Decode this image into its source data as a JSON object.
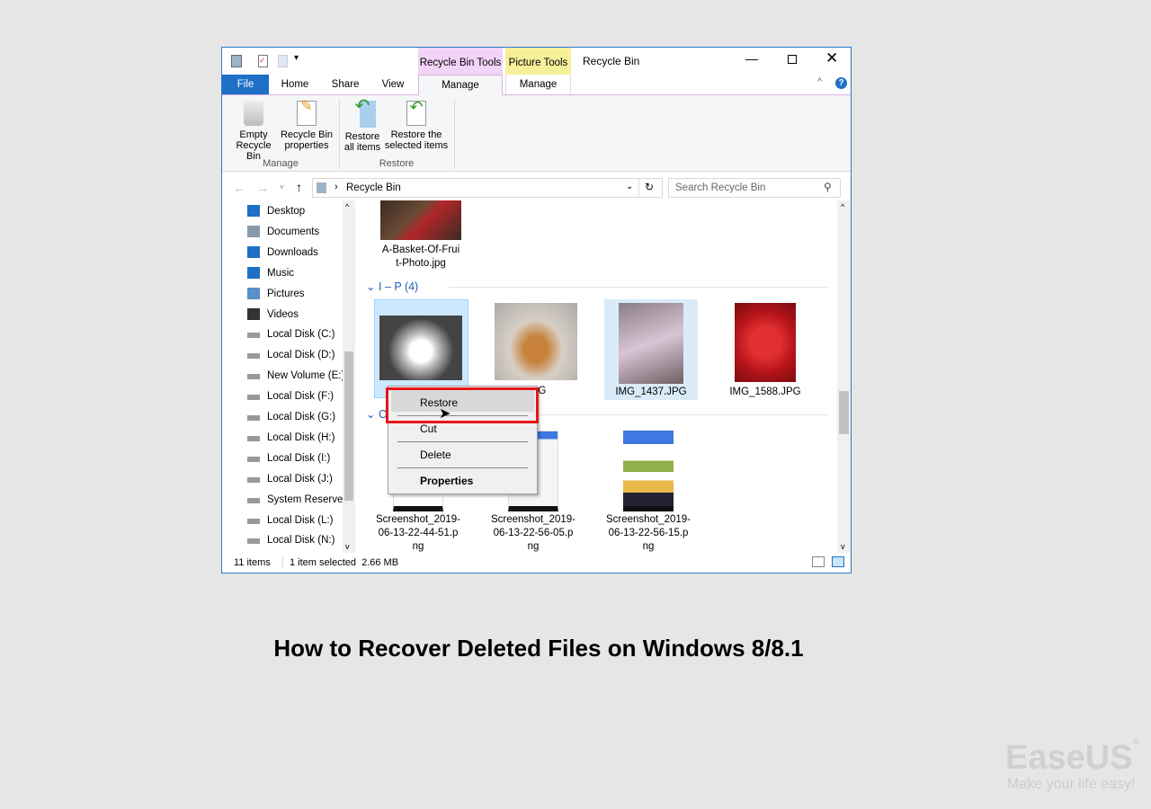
{
  "window": {
    "title": "Recycle Bin",
    "contextual_tabs": [
      "Recycle Bin Tools",
      "Picture Tools"
    ]
  },
  "tabs": {
    "file": "File",
    "home": "Home",
    "share": "Share",
    "view": "View",
    "manage1": "Manage",
    "manage2": "Manage"
  },
  "ribbon": {
    "empty": [
      "Empty",
      "Recycle Bin"
    ],
    "props": [
      "Recycle Bin",
      "properties"
    ],
    "restore_all": [
      "Restore",
      "all items"
    ],
    "restore_sel": [
      "Restore the",
      "selected items"
    ],
    "group_manage": "Manage",
    "group_restore": "Restore"
  },
  "address": {
    "path": "Recycle Bin",
    "search_placeholder": "Search Recycle Bin"
  },
  "nav": [
    "Desktop",
    "Documents",
    "Downloads",
    "Music",
    "Pictures",
    "Videos",
    "Local Disk (C:)",
    "Local Disk (D:)",
    "New Volume (E:)",
    "Local Disk (F:)",
    "Local Disk (G:)",
    "Local Disk (H:)",
    "Local Disk (I:)",
    "Local Disk (J:)",
    "System Reserved",
    "Local Disk (L:)",
    "Local Disk (N:)"
  ],
  "files": {
    "top": [
      "A-Basket-Of-Frui",
      "t-Photo.jpg"
    ],
    "group1": "I – P (4)",
    "group2": "O",
    "img2": "02.JPG",
    "img3": "IMG_1437.JPG",
    "img4": "IMG_1588.JPG",
    "shots": [
      [
        "Screenshot_2019-",
        "06-13-22-44-51.p",
        "ng"
      ],
      [
        "Screenshot_2019-",
        "06-13-22-56-05.p",
        "ng"
      ],
      [
        "Screenshot_2019-",
        "06-13-22-56-15.p",
        "ng"
      ]
    ]
  },
  "context_menu": {
    "restore": "Restore",
    "cut": "Cut",
    "delete": "Delete",
    "properties": "Properties"
  },
  "status": {
    "count": "11 items",
    "selected": "1 item selected  2.66 MB"
  },
  "caption": "How to Recover Deleted Files on Windows 8/8.1",
  "brand": {
    "name": "EaseUS",
    "tagline": "Make your life easy!",
    "mark": "®"
  }
}
